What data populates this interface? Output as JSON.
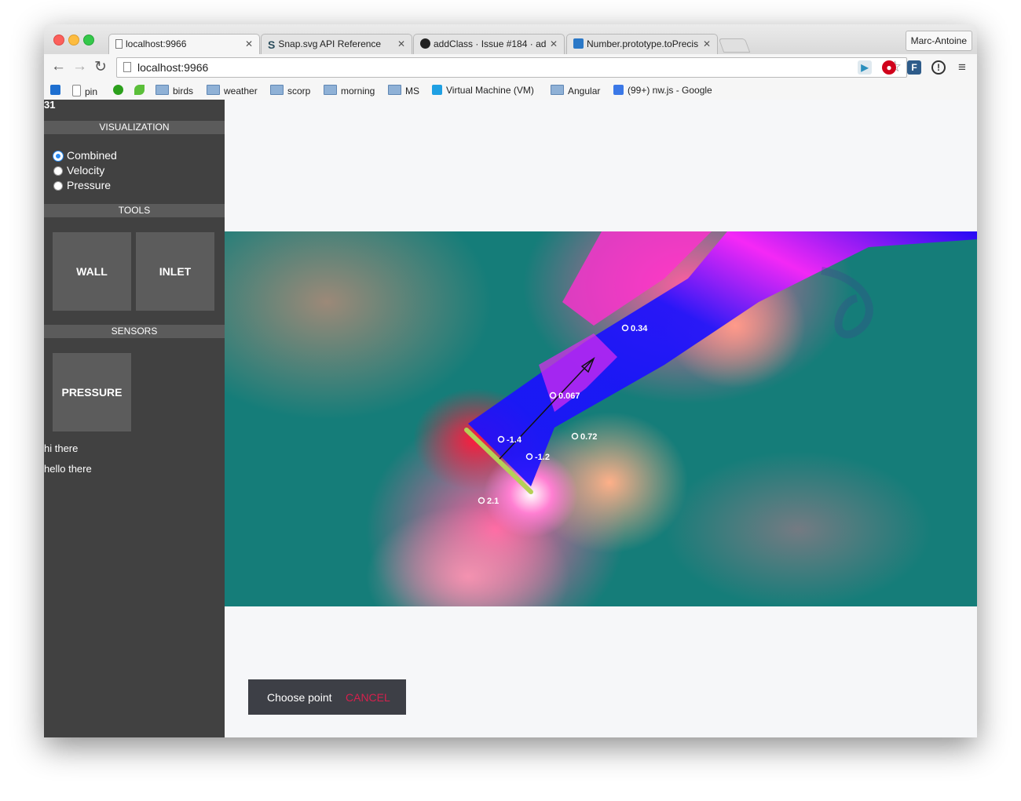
{
  "browser": {
    "tabs": [
      {
        "title": "localhost:9966",
        "icon": "page-icon",
        "active": true
      },
      {
        "title": "Snap.svg API Reference",
        "icon": "snap-icon",
        "active": false
      },
      {
        "title": "addClass · Issue #184 · ad",
        "icon": "github-icon",
        "active": false
      },
      {
        "title": "Number.prototype.toPrecis",
        "icon": "mdn-icon",
        "active": false
      }
    ],
    "close_glyph": "✕",
    "profile_name": "Marc-Antoine",
    "url": "localhost:9966",
    "bookmarks": [
      {
        "label": "",
        "icon": "trello-icon"
      },
      {
        "label": "pin",
        "icon": "page-icon"
      },
      {
        "label": "",
        "icon": "qb-icon"
      },
      {
        "label": "",
        "icon": "leaf-icon"
      },
      {
        "label": "birds",
        "icon": "folder-icon"
      },
      {
        "label": "weather",
        "icon": "folder-icon"
      },
      {
        "label": "scorp",
        "icon": "folder-icon"
      },
      {
        "label": "morning",
        "icon": "folder-icon"
      },
      {
        "label": "MS",
        "icon": "folder-icon"
      },
      {
        "label": "Virtual Machine (VM)",
        "icon": "ie-icon"
      },
      {
        "label": "Angular",
        "icon": "folder-icon"
      },
      {
        "label": "(99+) nw.js - Google",
        "icon": "gplus-icon"
      }
    ]
  },
  "app": {
    "counter": "31",
    "visualization": {
      "header": "VISUALIZATION",
      "options": [
        {
          "label": "Combined",
          "selected": true
        },
        {
          "label": "Velocity",
          "selected": false
        },
        {
          "label": "Pressure",
          "selected": false
        }
      ]
    },
    "tools": {
      "header": "TOOLS",
      "wall": "WALL",
      "inlet": "INLET"
    },
    "sensors": {
      "header": "SENSORS",
      "pressure": "PRESSURE"
    },
    "notes": [
      "hi there",
      "hello there"
    ],
    "probes": [
      {
        "value": "0.34"
      },
      {
        "value": "0.067"
      },
      {
        "value": "-1.4"
      },
      {
        "value": "0.72"
      },
      {
        "value": "-1.2"
      },
      {
        "value": "2.1"
      }
    ],
    "snackbar": {
      "message": "Choose point",
      "action": "CANCEL",
      "action_color": "#d6204d"
    },
    "colors": {
      "sidebar": "#414141",
      "section_header": "#5b5b5b",
      "button": "#5c5c5c",
      "wall": "#b5d056"
    }
  }
}
